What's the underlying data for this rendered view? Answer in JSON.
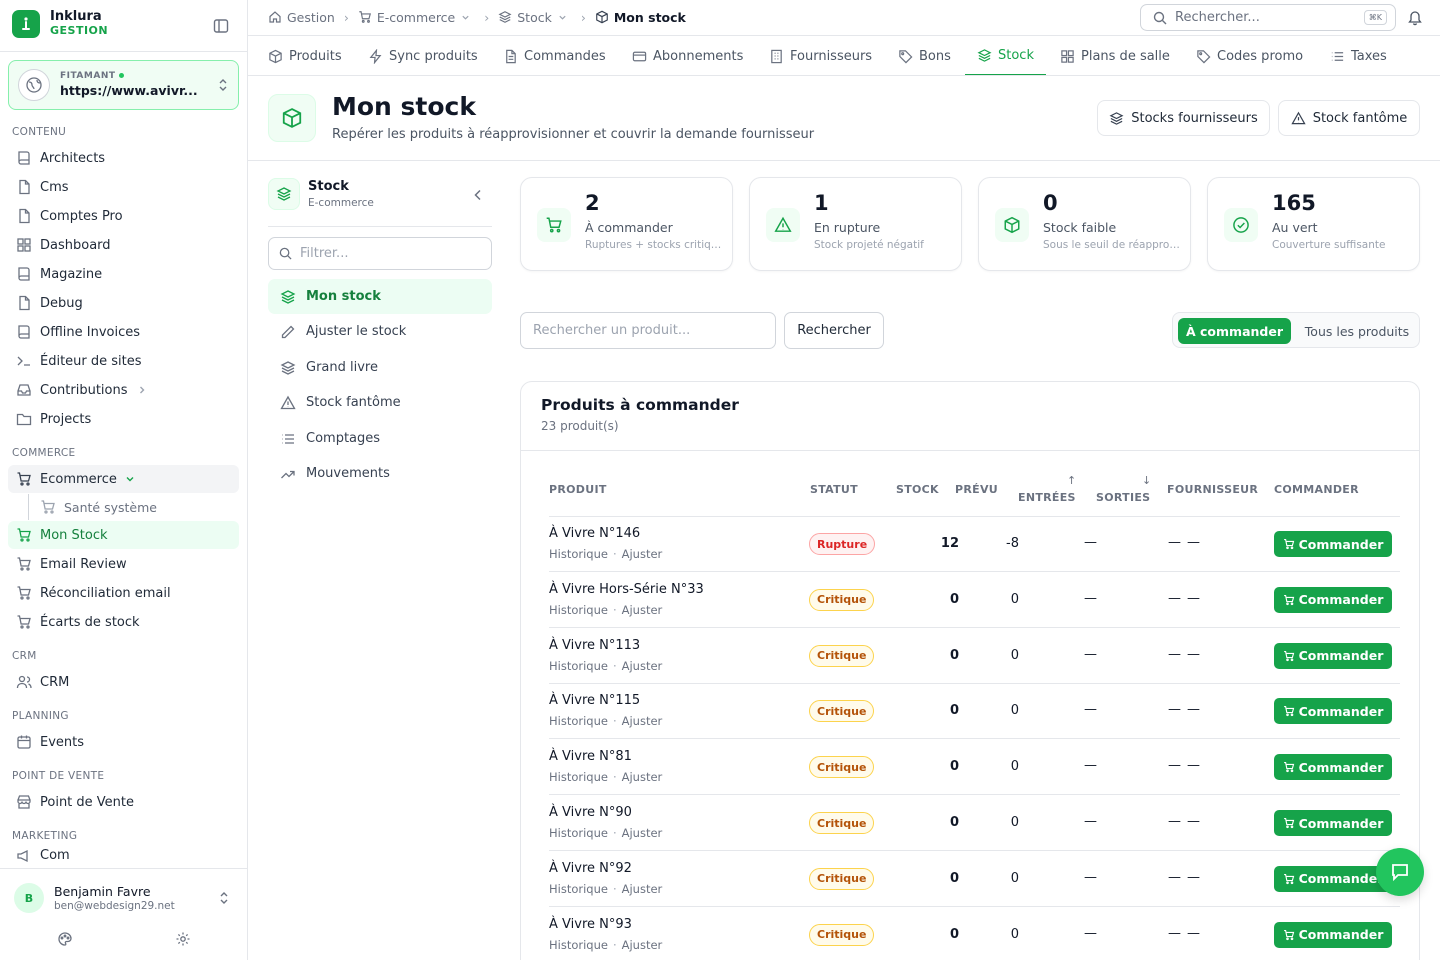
{
  "brand": {
    "name": "Inklura",
    "sub": "GESTION"
  },
  "site": {
    "tag": "FITAMANT",
    "url": "https://www.avivr..."
  },
  "sidebar": {
    "contenu": "CONTENU",
    "contenu_items": [
      "Architects",
      "Cms",
      "Comptes Pro",
      "Dashboard",
      "Magazine",
      "Debug",
      "Offline Invoices",
      "Éditeur de sites",
      "Contributions",
      "Projects"
    ],
    "commerce": "COMMERCE",
    "ecommerce": "Ecommerce",
    "sante": "Santé système",
    "commerce_items": [
      "Mon Stock",
      "Email Review",
      "Réconciliation email",
      "Écarts de stock"
    ],
    "crm": "CRM",
    "crm_item": "CRM",
    "planning": "PLANNING",
    "planning_item": "Events",
    "pdv": "POINT DE VENTE",
    "pdv_item": "Point de Vente",
    "marketing": "MARKETING",
    "marketing_item": "Com"
  },
  "user": {
    "initial": "B",
    "name": "Benjamin Favre",
    "email": "ben@webdesign29.net"
  },
  "breadcrumb": [
    "Gestion",
    "E-commerce",
    "Stock",
    "Mon stock"
  ],
  "search": {
    "placeholder": "Rechercher...",
    "shortcut": "⌘K"
  },
  "tabs": [
    "Produits",
    "Sync produits",
    "Commandes",
    "Abonnements",
    "Fournisseurs",
    "Bons",
    "Stock",
    "Plans de salle",
    "Codes promo",
    "Taxes"
  ],
  "header": {
    "title": "Mon stock",
    "subtitle": "Repérer les produits à réapprovisionner et couvrir la demande fournisseur",
    "btn_suppliers": "Stocks fournisseurs",
    "btn_phantom": "Stock fantôme"
  },
  "subnav": {
    "title": "Stock",
    "sub": "E-commerce",
    "filter": "Filtrer...",
    "items": [
      "Mon stock",
      "Ajuster le stock",
      "Grand livre",
      "Stock fantôme",
      "Comptages",
      "Mouvements"
    ]
  },
  "stats": [
    {
      "value": "2",
      "label": "À commander",
      "desc": "Ruptures + stocks critiques"
    },
    {
      "value": "1",
      "label": "En rupture",
      "desc": "Stock projeté négatif"
    },
    {
      "value": "0",
      "label": "Stock faible",
      "desc": "Sous le seuil de réapprovisionnement"
    },
    {
      "value": "165",
      "label": "Au vert",
      "desc": "Couverture suffisante"
    }
  ],
  "toolbar": {
    "placeholder": "Rechercher un produit...",
    "search_btn": "Rechercher",
    "seg_a": "À commander",
    "seg_b": "Tous les produits"
  },
  "table": {
    "title": "Produits à commander",
    "count": "23 produit(s)",
    "headers": {
      "produit": "PRODUIT",
      "statut": "STATUT",
      "stock": "STOCK",
      "prevu": "PRÉVU",
      "entrees": "ENTRÉES",
      "sorties": "SORTIES",
      "fournisseur": "FOURNISSEUR",
      "commander": "COMMANDER"
    },
    "link_hist": "Historique",
    "link_adj": "Ajuster",
    "cmd_label": "Commander",
    "rows": [
      {
        "name": "À Vivre N°146",
        "status": "Rupture",
        "stock": "12",
        "prevu": "-8",
        "in": "—",
        "out": "—",
        "sup": "—"
      },
      {
        "name": "À Vivre Hors-Série N°33",
        "status": "Critique",
        "stock": "0",
        "prevu": "0",
        "in": "—",
        "out": "—",
        "sup": "—"
      },
      {
        "name": "À Vivre N°113",
        "status": "Critique",
        "stock": "0",
        "prevu": "0",
        "in": "—",
        "out": "—",
        "sup": "—"
      },
      {
        "name": "À Vivre N°115",
        "status": "Critique",
        "stock": "0",
        "prevu": "0",
        "in": "—",
        "out": "—",
        "sup": "—"
      },
      {
        "name": "À Vivre N°81",
        "status": "Critique",
        "stock": "0",
        "prevu": "0",
        "in": "—",
        "out": "—",
        "sup": "—"
      },
      {
        "name": "À Vivre N°90",
        "status": "Critique",
        "stock": "0",
        "prevu": "0",
        "in": "—",
        "out": "—",
        "sup": "—"
      },
      {
        "name": "À Vivre N°92",
        "status": "Critique",
        "stock": "0",
        "prevu": "0",
        "in": "—",
        "out": "—",
        "sup": "—"
      },
      {
        "name": "À Vivre N°93",
        "status": "Critique",
        "stock": "0",
        "prevu": "0",
        "in": "—",
        "out": "—",
        "sup": "—"
      }
    ]
  }
}
